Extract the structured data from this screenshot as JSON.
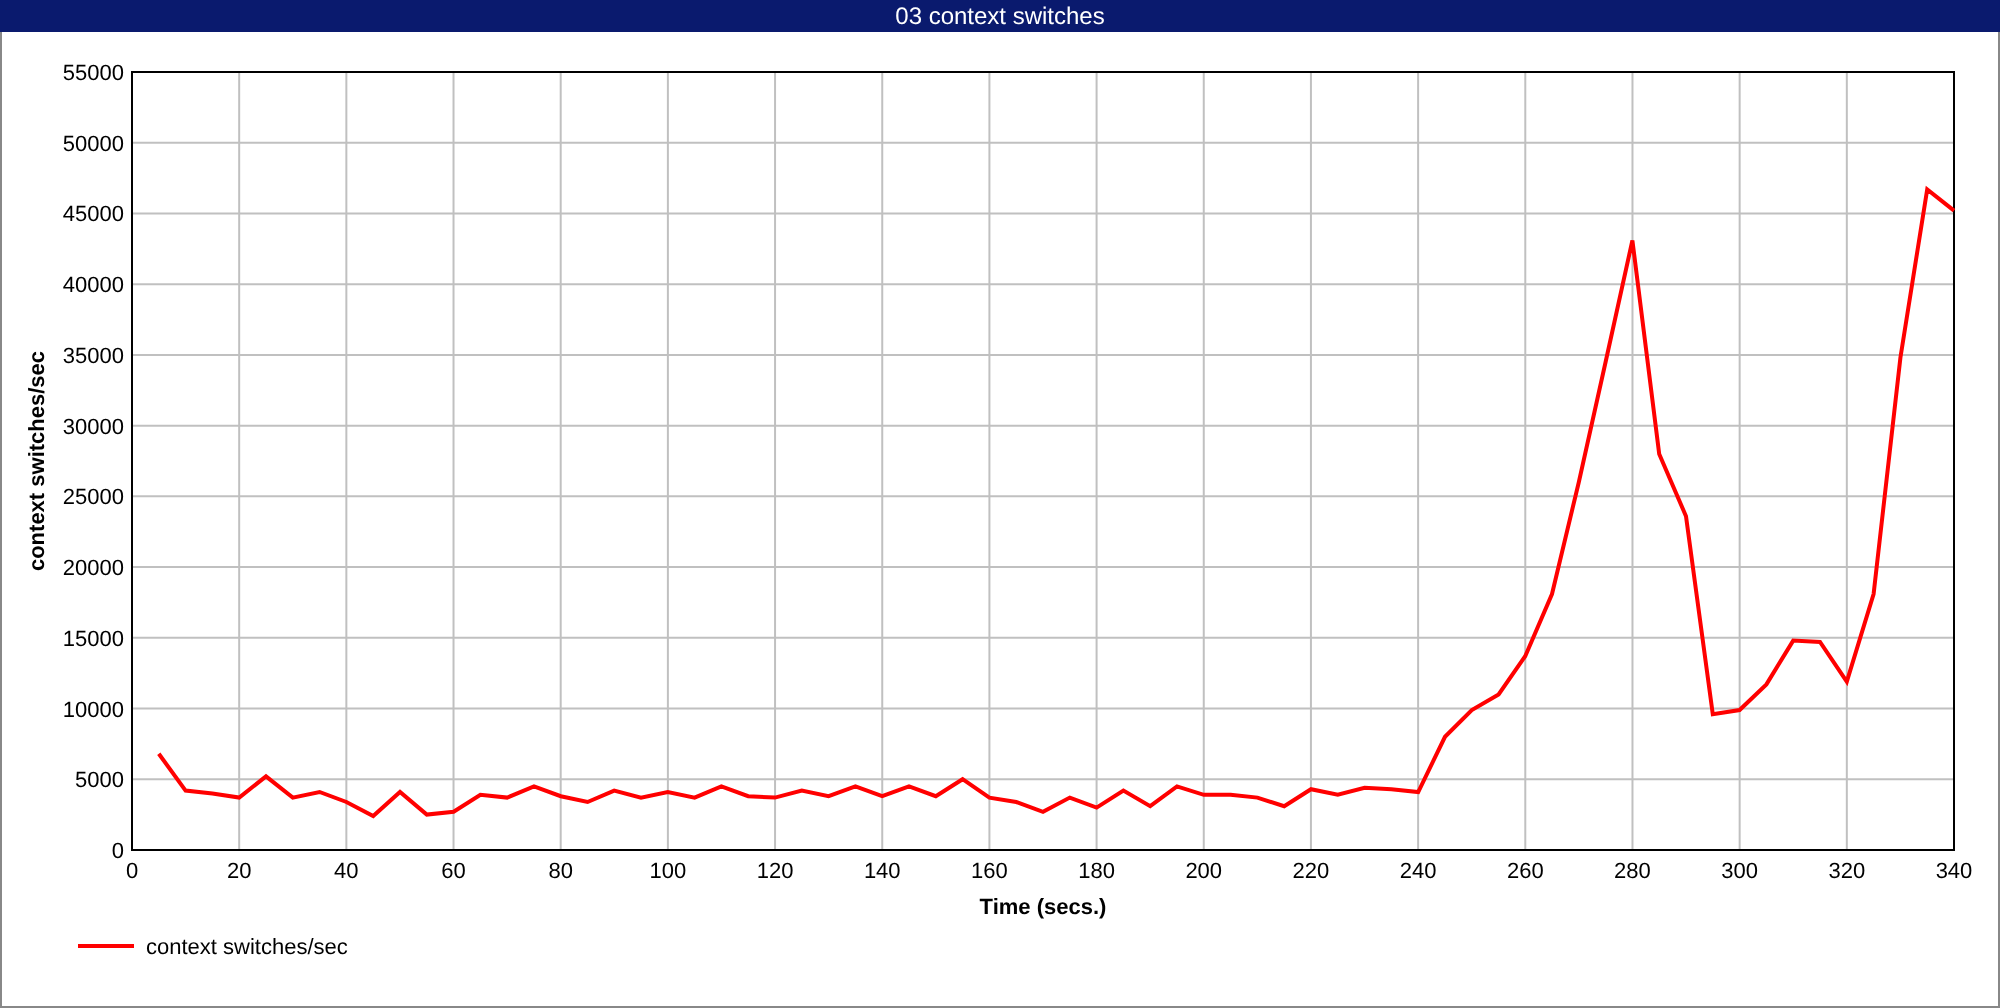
{
  "window": {
    "title": "03 context switches"
  },
  "chart": {
    "chart_data": {
      "type": "line",
      "xlabel": "Time (secs.)",
      "ylabel": "context switches/sec",
      "x": [
        5,
        10,
        15,
        20,
        25,
        30,
        35,
        40,
        45,
        50,
        55,
        60,
        65,
        70,
        75,
        80,
        85,
        90,
        95,
        100,
        105,
        110,
        115,
        120,
        125,
        130,
        135,
        140,
        145,
        150,
        155,
        160,
        165,
        170,
        175,
        180,
        185,
        190,
        195,
        200,
        205,
        210,
        215,
        220,
        225,
        230,
        235,
        240,
        245,
        250,
        255,
        260,
        265,
        270,
        275,
        280,
        285,
        290,
        295,
        300,
        305,
        310,
        315,
        320,
        325,
        330,
        335,
        340
      ],
      "series": [
        {
          "name": "context switches/sec",
          "color": "#ff0000",
          "values": [
            6800,
            4200,
            4000,
            3700,
            5200,
            3700,
            4100,
            3400,
            2400,
            4100,
            2500,
            2700,
            3900,
            3700,
            4500,
            3800,
            3400,
            4200,
            3700,
            4100,
            3700,
            4500,
            3800,
            3700,
            4200,
            3800,
            4500,
            3800,
            4500,
            3800,
            5000,
            3700,
            3400,
            2700,
            3700,
            3000,
            4200,
            3100,
            4500,
            3900,
            3900,
            3700,
            3100,
            4300,
            3900,
            4400,
            4300,
            4100,
            8000,
            9900,
            11000,
            13700,
            18100,
            26000,
            34500,
            43100,
            28000,
            23600,
            9600,
            9900,
            11700,
            14800,
            14700,
            11900,
            18100,
            34800,
            46700,
            45200
          ]
        }
      ],
      "grid": true,
      "xlim": [
        0,
        340
      ],
      "ylim": [
        0,
        55000
      ],
      "xticks": [
        0,
        20,
        40,
        60,
        80,
        100,
        120,
        140,
        160,
        180,
        200,
        220,
        240,
        260,
        280,
        300,
        320,
        340
      ],
      "yticks": [
        0,
        5000,
        10000,
        15000,
        20000,
        25000,
        30000,
        35000,
        40000,
        45000,
        50000,
        55000
      ]
    }
  }
}
